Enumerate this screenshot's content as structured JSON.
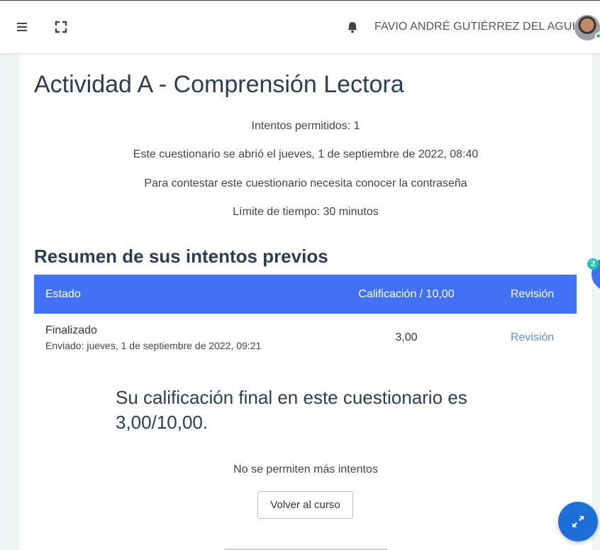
{
  "header": {
    "user_name": "FAVIO ANDRÉ GUTIÉRREZ DEL AGUILA",
    "icons": {
      "menu": "hamburger-icon",
      "fullscreen": "fullscreen-icon",
      "notifications": "bell-icon"
    }
  },
  "quiz": {
    "title": "Actividad A - Comprensión Lectora",
    "info": [
      "Intentos permitidos: 1",
      "Este cuestionario se abrió el jueves, 1 de septiembre de 2022, 08:40",
      "Para contestar este cuestionario necesita conocer la contraseña",
      "Límite de tiempo: 30 minutos"
    ]
  },
  "summary": {
    "title": "Resumen de sus intentos previos",
    "columns": {
      "state": "Estado",
      "grade": "Calificación / 10,00",
      "review": "Revisión"
    },
    "rows": [
      {
        "state": "Finalizado",
        "submitted": "Enviado: jueves, 1 de septiembre de 2022, 09:21",
        "grade": "3,00",
        "review": "Revisión"
      }
    ]
  },
  "final_grade_text": "Su calificación final en este cuestionario es 3,00/10,00.",
  "no_more_attempts": "No se permiten más intentos",
  "back_button_label": "Volver al curso",
  "side_badge_count": "2",
  "colors": {
    "accent": "#4271f5",
    "fab": "#1f6fd8",
    "badge": "#19c9b5",
    "link": "#5b8fd9"
  }
}
